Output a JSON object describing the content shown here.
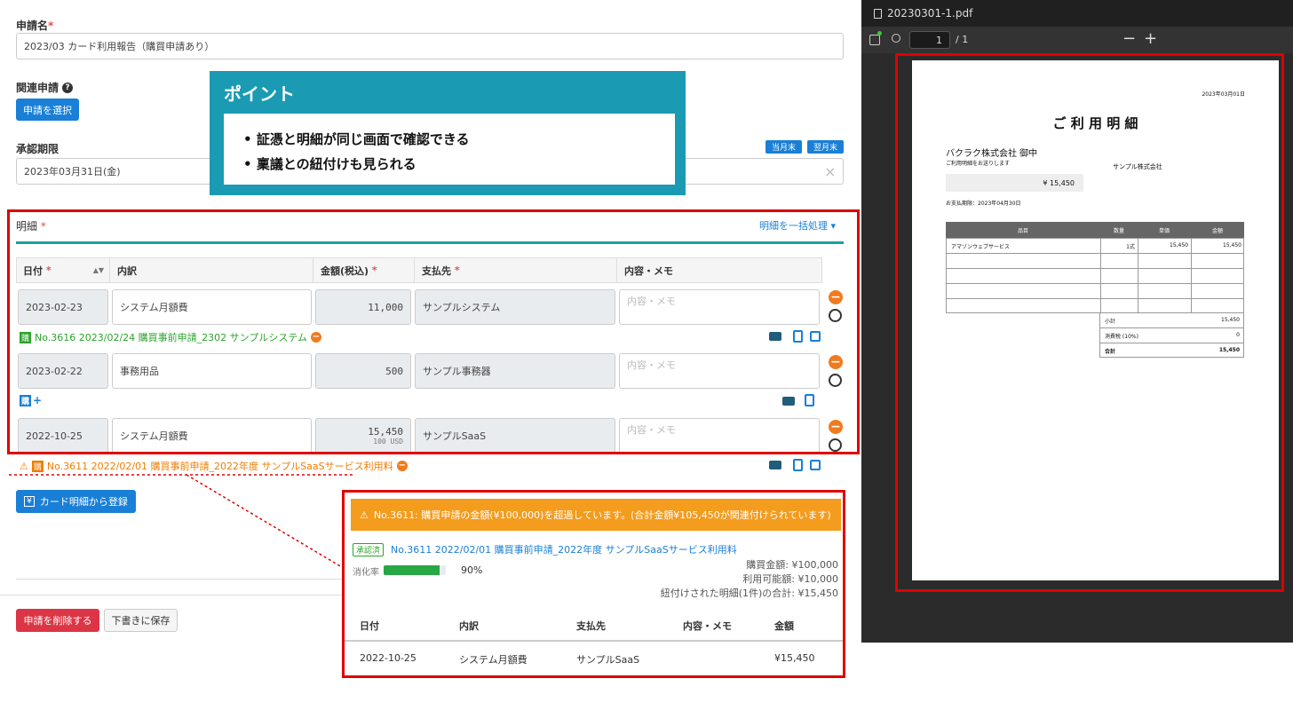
{
  "form": {
    "app_name_label": "申請名",
    "app_name_value": "2023/03 カード利用報告（購買申請あり）",
    "related_label": "関連申請",
    "related_help_icon": "question-circle-icon",
    "select_app_button": "申請を選択",
    "deadline_label": "承認期限",
    "deadline_value": "2023年03月31日(金)",
    "badge_this_month": "当月末",
    "badge_next_month": "翌月末",
    "clear_icon": "×",
    "details_label": "明細",
    "bulk_action": "明細を一括処理 ▾",
    "required_mark": "*"
  },
  "point": {
    "title": "ポイント",
    "items": [
      "証憑と明細が同じ画面で確認できる",
      "稟議との紐付けも見られる"
    ]
  },
  "table": {
    "headers": [
      "日付",
      "内訳",
      "金額(税込)",
      "支払先",
      "内容・メモ"
    ],
    "memo_placeholder": "内容・メモ",
    "rows": [
      {
        "date": "2023-02-23",
        "item": "システム月額費",
        "amount": "11,000",
        "amount_sub": "",
        "payee": "サンプルシステム"
      },
      {
        "date": "2023-02-22",
        "item": "事務用品",
        "amount": "500",
        "amount_sub": "",
        "payee": "サンプル事務器"
      },
      {
        "date": "2022-10-25",
        "item": "システム月額費",
        "amount": "15,450",
        "amount_sub": "100 USD",
        "payee": "サンプルSaaS"
      }
    ],
    "link1": "No.3616 2023/02/24 購買事前申請_2302 サンプルシステム",
    "link1_tag": "購",
    "link2_tag": "購",
    "link2_plus": "+",
    "link3": "No.3611 2022/02/01 購買事前申請_2022年度 サンプルSaaSサービス利用料",
    "link3_tag": "購"
  },
  "actions": {
    "card_register": "カード明細から登録",
    "yen_icon": "¥",
    "delete_button": "申請を削除する",
    "save_draft_button": "下書きに保存"
  },
  "popup": {
    "warning": "No.3611: 購買申請の金額(¥100,000)を超過しています。(合計金額¥105,450が関連付けられています)",
    "status_badge": "承認済",
    "title_link": "No.3611 2022/02/01 購買事前申請_2022年度 サンプルSaaSサービス利用料",
    "consumption_label": "消化率",
    "consumption_value": "90%",
    "consumption_ratio": 0.9,
    "purchase_amount": "購買金額: ¥100,000",
    "available_amount": "利用可能額: ¥10,000",
    "linked_total": "紐付けされた明細(1件)の合計: ¥15,450",
    "headers": [
      "日付",
      "内訳",
      "支払先",
      "内容・メモ",
      "金額"
    ],
    "row": {
      "date": "2022-10-25",
      "item": "システム月額費",
      "payee": "サンプルSaaS",
      "memo": "",
      "amount": "¥15,450"
    }
  },
  "pdf": {
    "filename": "20230301-1.pdf",
    "page_input": "1",
    "page_total": "/ 1",
    "zoom_out": "−",
    "zoom_in": "+",
    "date": "2023年03月01日",
    "title": "ご 利 用 明 細",
    "recipient": "バクラク株式会社 御中",
    "intro": "ご利用明細をお送りします",
    "sender": "サンプル株式会社",
    "total_box": "¥ 15,450",
    "due": "お支払期限：2023年04月30日",
    "headers": [
      "品目",
      "数量",
      "単価",
      "金額"
    ],
    "row": {
      "item": "アマゾンウェブサービス",
      "qty": "1式",
      "unit": "15,450",
      "amount": "15,450"
    },
    "subtotal_label": "小計",
    "subtotal": "15,450",
    "tax_label": "消費税 (10%)",
    "tax": "0",
    "total_label": "合計",
    "total": "15,450"
  }
}
